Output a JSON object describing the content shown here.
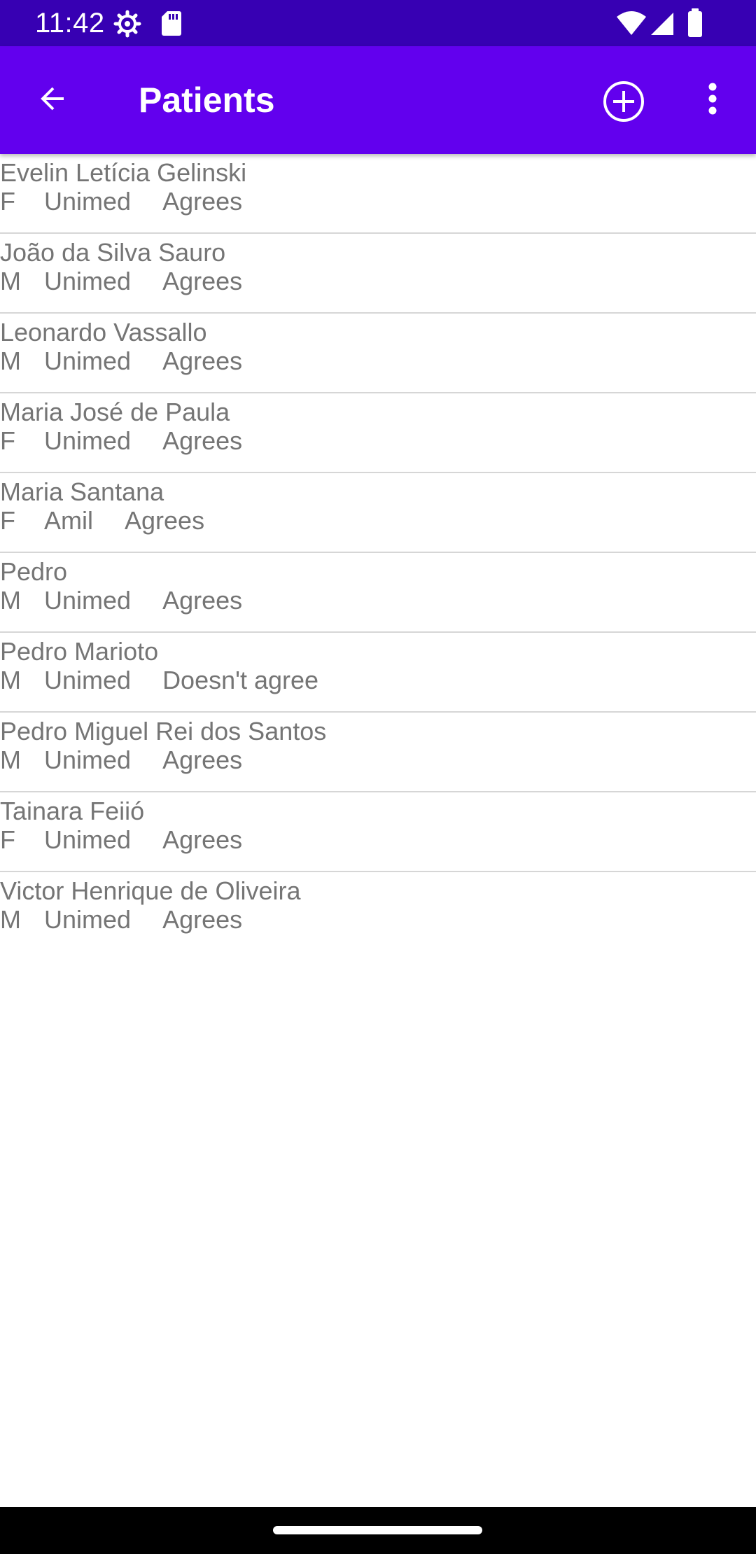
{
  "status_bar": {
    "time": "11:42",
    "icons": [
      "settings-icon",
      "sd-card-icon",
      "wifi-icon",
      "signal-icon",
      "battery-icon"
    ]
  },
  "app_bar": {
    "title": "Patients",
    "back_icon": "arrow-back-icon",
    "add_icon": "add-circle-icon",
    "more_icon": "more-vert-icon"
  },
  "patients": [
    {
      "name": "Evelin Letícia Gelinski",
      "sex": "F",
      "plan": "Unimed",
      "consent": "Agrees"
    },
    {
      "name": "João da Silva Sauro",
      "sex": "M",
      "plan": "Unimed",
      "consent": "Agrees"
    },
    {
      "name": "Leonardo Vassallo",
      "sex": "M",
      "plan": "Unimed",
      "consent": "Agrees"
    },
    {
      "name": "Maria José de Paula",
      "sex": "F",
      "plan": "Unimed",
      "consent": "Agrees"
    },
    {
      "name": "Maria Santana",
      "sex": "F",
      "plan": "Amil",
      "consent": "Agrees"
    },
    {
      "name": "Pedro",
      "sex": "M",
      "plan": "Unimed",
      "consent": "Agrees"
    },
    {
      "name": "Pedro Marioto",
      "sex": "M",
      "plan": "Unimed",
      "consent": "Doesn't agree"
    },
    {
      "name": "Pedro Miguel Rei dos Santos",
      "sex": "M",
      "plan": "Unimed",
      "consent": "Agrees"
    },
    {
      "name": "Tainara Feiió",
      "sex": "F",
      "plan": "Unimed",
      "consent": "Agrees"
    },
    {
      "name": "Victor Henrique de Oliveira",
      "sex": "M",
      "plan": "Unimed",
      "consent": "Agrees"
    }
  ],
  "colors": {
    "status_bar": "#3700B3",
    "app_bar": "#6200EE",
    "text_secondary": "#757575",
    "divider": "#D6D6D6"
  }
}
